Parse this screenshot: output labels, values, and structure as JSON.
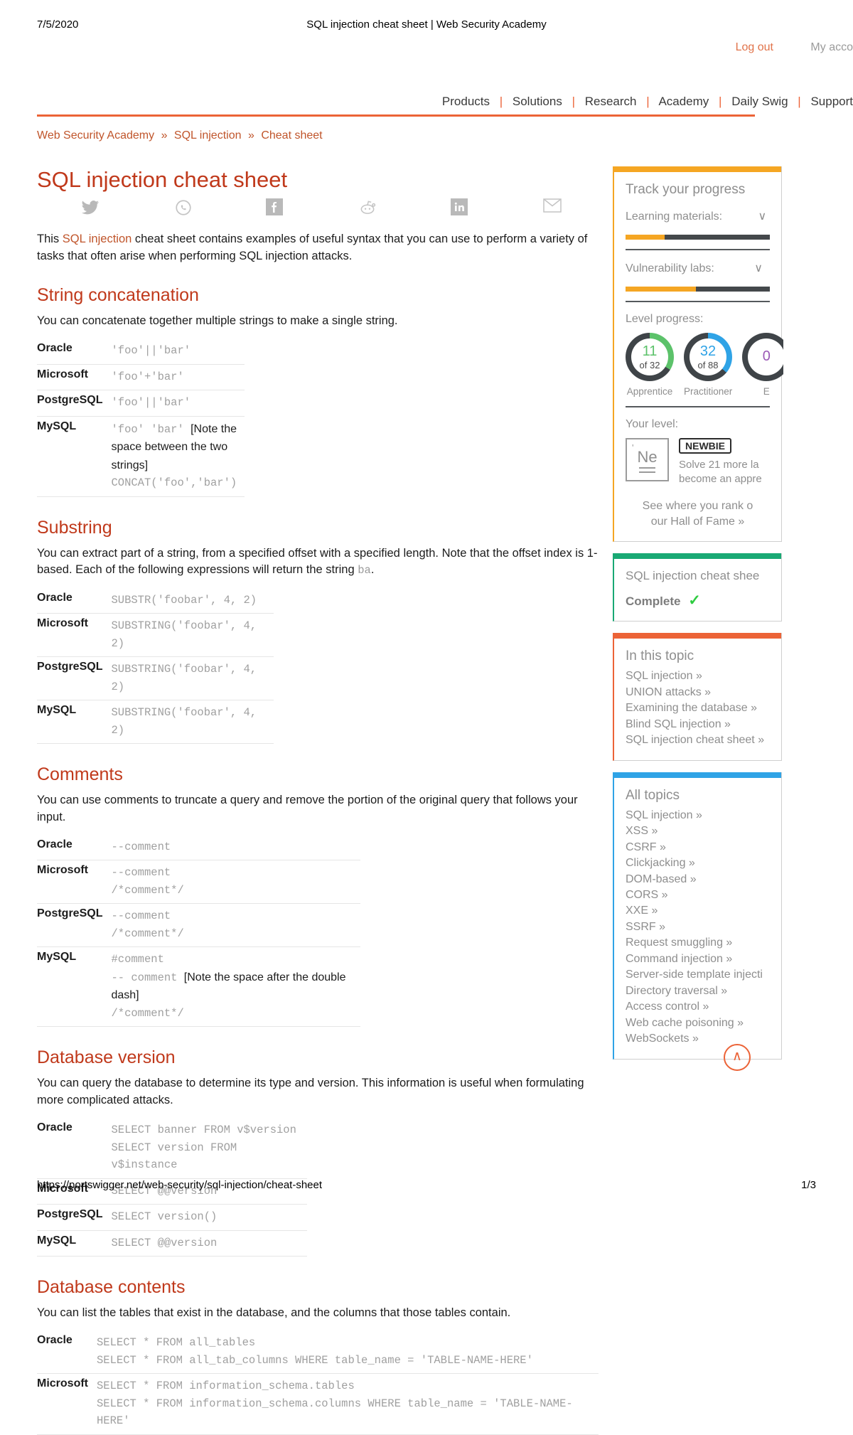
{
  "print": {
    "date": "7/5/2020",
    "doc_title": "SQL injection cheat sheet | Web Security Academy",
    "url": "https://portswigger.net/web-security/sql-injection/cheat-sheet",
    "page": "1/3"
  },
  "account": {
    "logout": "Log out",
    "my_account": "My acco"
  },
  "nav": {
    "items": [
      "Products",
      "Solutions",
      "Research",
      "Academy",
      "Daily Swig",
      "Support"
    ],
    "separator": "|"
  },
  "breadcrumb": {
    "items": [
      "Web Security Academy",
      "SQL injection",
      "Cheat sheet"
    ],
    "chevron": "»"
  },
  "article": {
    "title": "SQL injection cheat sheet",
    "share_icons": [
      "twitter-icon",
      "whatsapp-icon",
      "facebook-icon",
      "reddit-icon",
      "linkedin-icon",
      "email-icon"
    ],
    "intro_before": "This ",
    "intro_link": "SQL injection",
    "intro_after": " cheat sheet contains examples of useful syntax that you can use to perform a variety of tasks that often arise when performing SQL injection attacks.",
    "sections": [
      {
        "heading": "String concatenation",
        "intro": "You can concatenate together multiple strings to make a single string.",
        "table_class": "tw1",
        "rows": [
          {
            "db": "Oracle",
            "lines": [
              {
                "code": "'foo'||'bar'"
              }
            ]
          },
          {
            "db": "Microsoft",
            "lines": [
              {
                "code": "'foo'+'bar'"
              }
            ]
          },
          {
            "db": "PostgreSQL",
            "lines": [
              {
                "code": "'foo'||'bar'"
              }
            ]
          },
          {
            "db": "MySQL",
            "lines": [
              {
                "code": "'foo' 'bar'",
                "note": "[Note the space between the two strings]"
              },
              {
                "code": "CONCAT('foo','bar')"
              }
            ]
          }
        ]
      },
      {
        "heading": "Substring",
        "intro_before": "You can extract part of a string, from a specified offset with a specified length. Note that the offset index is 1-based. Each of the following expressions will return the string ",
        "intro_code": "ba",
        "intro_after": ".",
        "table_class": "tw2",
        "rows": [
          {
            "db": "Oracle",
            "lines": [
              {
                "code": "SUBSTR('foobar', 4, 2)"
              }
            ]
          },
          {
            "db": "Microsoft",
            "lines": [
              {
                "code": "SUBSTRING('foobar', 4, 2)"
              }
            ]
          },
          {
            "db": "PostgreSQL",
            "lines": [
              {
                "code": "SUBSTRING('foobar', 4, 2)"
              }
            ]
          },
          {
            "db": "MySQL",
            "lines": [
              {
                "code": "SUBSTRING('foobar', 4, 2)"
              }
            ]
          }
        ]
      },
      {
        "heading": "Comments",
        "intro": "You can use comments to truncate a query and remove the portion of the original query that follows your input.",
        "table_class": "tw3",
        "rows": [
          {
            "db": "Oracle",
            "lines": [
              {
                "code": "--comment"
              }
            ]
          },
          {
            "db": "Microsoft",
            "lines": [
              {
                "code": "--comment"
              },
              {
                "code": "/*comment*/"
              }
            ]
          },
          {
            "db": "PostgreSQL",
            "lines": [
              {
                "code": "--comment"
              },
              {
                "code": "/*comment*/"
              }
            ]
          },
          {
            "db": "MySQL",
            "lines": [
              {
                "code": "#comment"
              },
              {
                "code": "-- comment",
                "note": "[Note the space after the double dash]"
              },
              {
                "code": "/*comment*/"
              }
            ]
          }
        ]
      },
      {
        "heading": "Database version",
        "intro": "You can query the database to determine its type and version. This information is useful when formulating more complicated attacks.",
        "table_class": "tw4",
        "rows": [
          {
            "db": "Oracle",
            "lines": [
              {
                "code": "SELECT banner FROM v$version"
              },
              {
                "code": "SELECT version FROM v$instance"
              }
            ]
          },
          {
            "db": "Microsoft",
            "lines": [
              {
                "code": "SELECT @@version"
              }
            ]
          },
          {
            "db": "PostgreSQL",
            "lines": [
              {
                "code": "SELECT version()"
              }
            ]
          },
          {
            "db": "MySQL",
            "lines": [
              {
                "code": "SELECT @@version"
              }
            ]
          }
        ]
      },
      {
        "heading": "Database contents",
        "intro": "You can list the tables that exist in the database, and the columns that those tables contain.",
        "table_class": "tw5",
        "rows": [
          {
            "db": "Oracle",
            "lines": [
              {
                "code": "SELECT * FROM all_tables"
              },
              {
                "code": "SELECT * FROM all_tab_columns WHERE table_name = 'TABLE-NAME-HERE'"
              }
            ]
          },
          {
            "db": "Microsoft",
            "lines": [
              {
                "code": "SELECT * FROM information_schema.tables"
              },
              {
                "code": "SELECT * FROM information_schema.columns WHERE table_name = 'TABLE-NAME-HERE'"
              }
            ]
          }
        ]
      }
    ]
  },
  "sidebar": {
    "progress": {
      "accent": "#f5a623",
      "title": "Track your progress",
      "learning_label": "Learning materials:",
      "learning_value": "∨",
      "learning_percent": 27,
      "labs_label": "Vulnerability labs:",
      "labs_value": "∨",
      "labs_percent": 49,
      "level_label": "Level progress:",
      "circles": [
        {
          "num": "11",
          "of": "of 32",
          "caption": "Apprentice",
          "color": "#5cc26a",
          "percent": 34
        },
        {
          "num": "32",
          "of": "of 88",
          "caption": "Practitioner",
          "color": "#2fa3e6",
          "percent": 36
        },
        {
          "num": "0",
          "of": "",
          "caption": "E",
          "color": "#9b59b6",
          "percent": 0
        }
      ],
      "your_level_label": "Your level:",
      "element_symbol": "Ne",
      "element_tick": "'",
      "badge": "NEWBIE",
      "level_line1": "Solve 21 more la",
      "level_line2": "become an appre",
      "hall_line1": "See where you rank o",
      "hall_line2": "our Hall of Fame »"
    },
    "complete_card": {
      "accent": "#19a974",
      "title": "SQL injection cheat shee",
      "status": "Complete",
      "check": "✓"
    },
    "in_this_topic": {
      "accent": "#ec6337",
      "title": "In this topic",
      "items": [
        "SQL injection »",
        "UNION attacks »",
        "Examining the database »",
        "Blind SQL injection »",
        "SQL injection cheat sheet »"
      ]
    },
    "all_topics": {
      "accent": "#2fa3e6",
      "title": "All topics",
      "items": [
        "SQL injection »",
        "XSS »",
        "CSRF »",
        "Clickjacking »",
        "DOM-based »",
        "CORS »",
        "XXE »",
        "SSRF »",
        "Request smuggling »",
        "Command injection »",
        "Server-side template injecti",
        "Directory traversal »",
        "Access control »",
        "Web cache poisoning »",
        "WebSockets »"
      ]
    },
    "scroll_top": "∧"
  }
}
